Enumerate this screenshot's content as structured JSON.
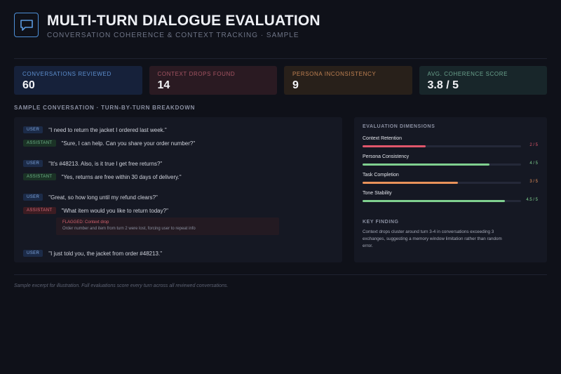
{
  "header": {
    "title": "MULTI-TURN DIALOGUE EVALUATION",
    "subtitle": "CONVERSATION COHERENCE & CONTEXT TRACKING · SAMPLE",
    "icon": "chat-bubble-icon"
  },
  "stats": [
    {
      "label": "CONVERSATIONS REVIEWED",
      "value": "60",
      "color": "#5d8fcf"
    },
    {
      "label": "CONTEXT DROPS FOUND",
      "value": "14",
      "color": "#a45462"
    },
    {
      "label": "PERSONA INCONSISTENCY",
      "value": "9",
      "color": "#bf8152"
    },
    {
      "label": "AVG. COHERENCE SCORE",
      "value": "3.8 / 5",
      "color": "#6aa28d"
    }
  ],
  "conversation": {
    "heading": "SAMPLE CONVERSATION · TURN-BY-TURN BREAKDOWN",
    "turns": [
      {
        "role": "USER",
        "text": "\"I need to return the jacket I ordered last week.\""
      },
      {
        "role": "ASSISTANT",
        "text": "\"Sure, I can help. Can you share your order number?\""
      },
      {
        "role": "USER",
        "text": "\"It's #48213. Also, is it true I get free returns?\""
      },
      {
        "role": "ASSISTANT",
        "text": "\"Yes, returns are free within 30 days of delivery.\""
      },
      {
        "role": "USER",
        "text": "\"Great, so how long until my refund clears?\""
      },
      {
        "role": "ASSISTANT",
        "text": "\"What item would you like to return today?\"",
        "flagged": true
      },
      {
        "role": "USER",
        "text": "\"I just told you, the jacket from order #48213.\""
      }
    ],
    "flag": {
      "title": "FLAGGED: Context drop",
      "detail": "Order number and item from turn 2 were lost, forcing user to repeat info"
    }
  },
  "evaluation": {
    "heading": "EVALUATION DIMENSIONS",
    "dimensions": [
      {
        "name": "Context Retention",
        "score": "2 / 5",
        "fraction": 0.4,
        "color": "#e0566b"
      },
      {
        "name": "Persona Consistency",
        "score": "4 / 5",
        "fraction": 0.8,
        "color": "#7fd08f"
      },
      {
        "name": "Task Completion",
        "score": "3 / 5",
        "fraction": 0.6,
        "color": "#e8925a"
      },
      {
        "name": "Tone Stability",
        "score": "4.5 / 5",
        "fraction": 0.9,
        "color": "#7fd08f"
      }
    ],
    "key_finding_heading": "KEY FINDING",
    "key_finding": "Context drops cluster around turn 3-4 in conversations exceeding 3 exchanges, suggesting a memory window limitation rather than random error."
  },
  "footer": "Sample excerpt for illustration. Full evaluations score every turn across all reviewed conversations."
}
